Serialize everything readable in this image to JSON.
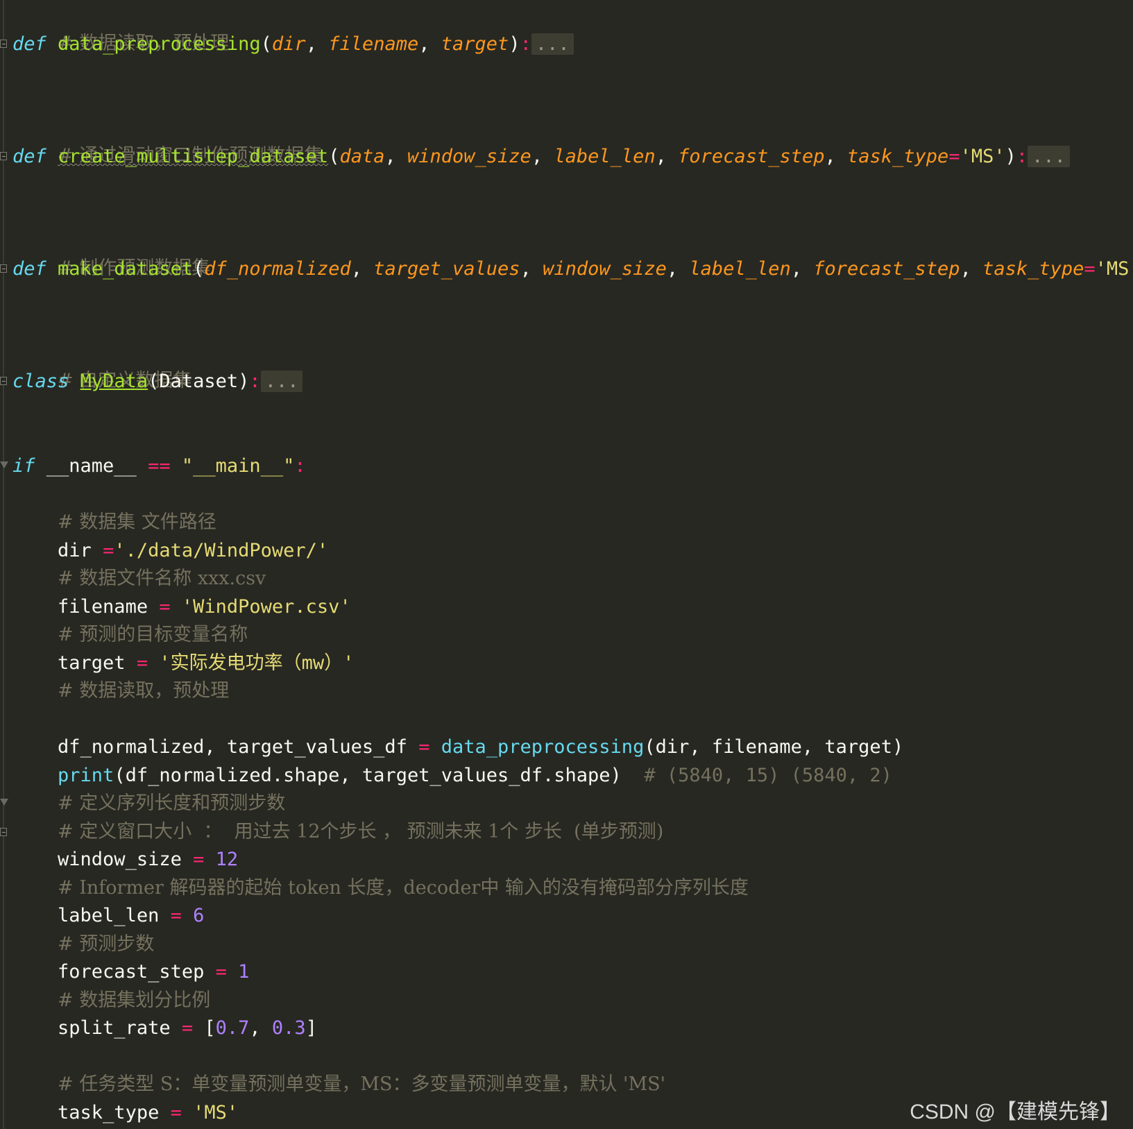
{
  "code": {
    "l1": {
      "comment": "# 数据读取，预处理"
    },
    "l2": {
      "kw": "def",
      "fn": "data_preprocessing",
      "open": "(",
      "p1": "dir",
      "c1": ", ",
      "p2": "filename",
      "c2": ", ",
      "p3": "target",
      "close": ")",
      "colon": ":",
      "fold": "..."
    },
    "l3": {
      "comment": "# 通过滑动窗口制作预测数据集"
    },
    "l4": {
      "kw": "def",
      "fn": "create_multistep_dataset",
      "open": "(",
      "p1": "data",
      "c1": ", ",
      "p2": "window_size",
      "c2": ", ",
      "p3": "label_len",
      "c3": ", ",
      "p4": "forecast_step",
      "c4": ", ",
      "p5": "task_type",
      "eq": "=",
      "val": "'MS'",
      "close": ")",
      "colon": ":",
      "fold": "..."
    },
    "l5": {
      "comment": "# 制作预测数据集"
    },
    "l6": {
      "kw": "def",
      "fn": "make_dataset",
      "open": "(",
      "p1": "df_normalized",
      "c1": ", ",
      "p2": "target_values",
      "c2": ", ",
      "p3": "window_size",
      "c3": ", ",
      "p4": "label_len",
      "c4": ", ",
      "p5": "forecast_step",
      "c5": ", ",
      "p6": "task_type",
      "eq": "=",
      "val": "'MS'",
      "c6": ","
    },
    "l7": {
      "comment": "# 自定义数据集"
    },
    "l8": {
      "kw": "class",
      "name": "MyData",
      "open": "(",
      "base": "Dataset",
      "close": ")",
      "colon": ":",
      "fold": "..."
    },
    "l9": {
      "kw": "if",
      "a": " __name__ ",
      "op": "==",
      "str": " \"__main__\"",
      "colon": ":"
    },
    "l10": {
      "comment": "# 数据集 文件路径"
    },
    "l11": {
      "var": "dir ",
      "op": "=",
      "str": "'./data/WindPower/'"
    },
    "l12": {
      "comment": "# 数据文件名称 xxx.csv"
    },
    "l13": {
      "var": "filename ",
      "op": "=",
      "str": " 'WindPower.csv'"
    },
    "l14": {
      "comment": "# 预测的目标变量名称"
    },
    "l15": {
      "var": "target ",
      "op": "=",
      "str": " '实际发电功率（mw）'"
    },
    "l16": {
      "comment": "# 数据读取，预处理"
    },
    "l17": {
      "a": "df_normalized, target_values_df ",
      "op": "=",
      "fn": " data_preprocessing",
      "b": "(dir, filename, target)"
    },
    "l18": {
      "fn": "print",
      "b": "(df_normalized.shape, target_values_df.shape)",
      "comment": "  # (5840, 15) (5840, 2)"
    },
    "l19": {
      "comment": "# 定义序列长度和预测步数"
    },
    "l20": {
      "comment": "# 定义窗口大小  ：  用过去 12个步长 ， 预测未来 1个 步长  (单步预测)"
    },
    "l21": {
      "var": "window_size ",
      "op": "=",
      "num": " 12"
    },
    "l22": {
      "comment": "# Informer 解码器的起始 token 长度，decoder中 输入的没有掩码部分序列长度"
    },
    "l23": {
      "var": "label_len ",
      "op": "=",
      "num": " 6"
    },
    "l24": {
      "comment": "# 预测步数"
    },
    "l25": {
      "var": "forecast_step ",
      "op": "=",
      "num": " 1"
    },
    "l26": {
      "comment": "# 数据集划分比例"
    },
    "l27": {
      "var": "split_rate ",
      "op": "=",
      "open": " [",
      "n1": "0.7",
      "sep": ", ",
      "n2": "0.3",
      "close": "]"
    },
    "l28": {
      "comment": "# 任务类型 S：单变量预测单变量，MS：多变量预测单变量，默认 'MS'"
    },
    "l29": {
      "var": "task_type ",
      "op": "=",
      "str": " 'MS'"
    }
  },
  "watermark": "CSDN @【建模先锋】"
}
